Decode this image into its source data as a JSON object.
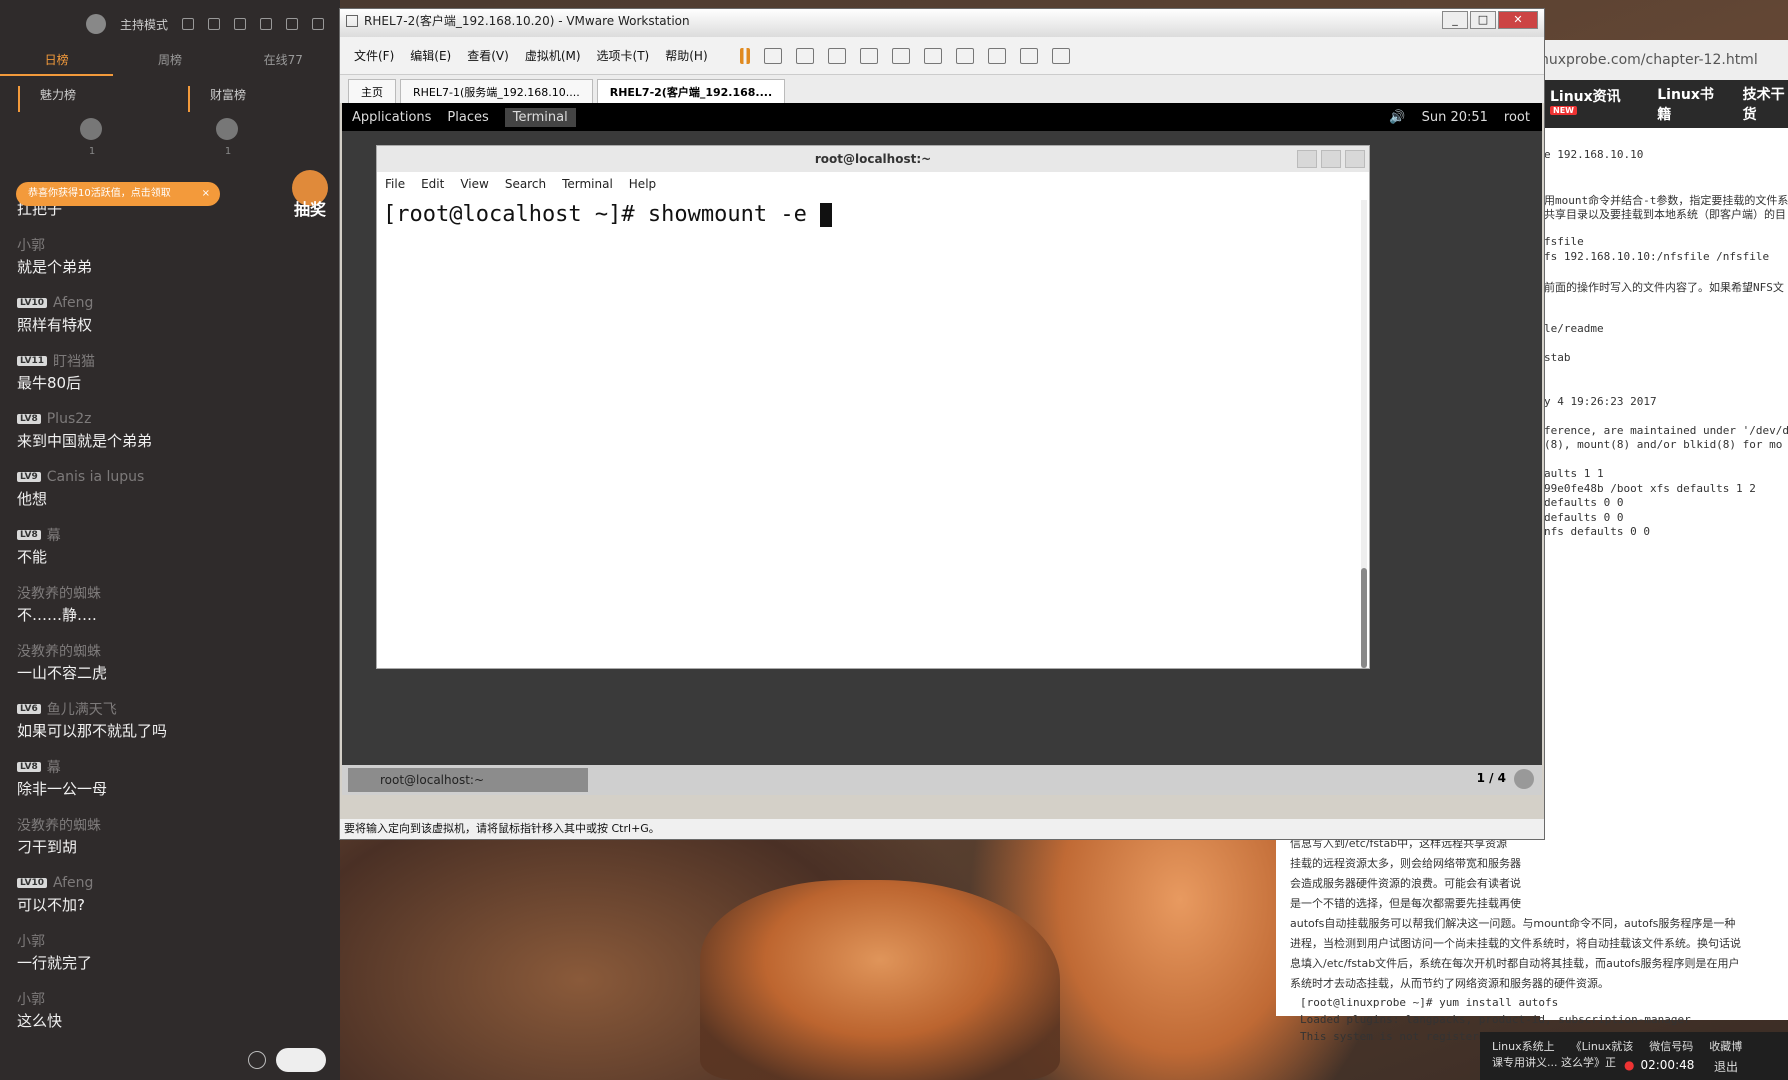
{
  "chat": {
    "host_mode": "主持模式",
    "tabs": [
      "日榜",
      "周榜",
      "在线77"
    ],
    "rank_heads": [
      "魅力榜",
      "财富榜"
    ],
    "rank_counts": [
      "1",
      "1"
    ],
    "toast": "恭喜你获得10活跃值，点击领取",
    "toast_close": "×",
    "lottery": "抽奖",
    "messages": [
      {
        "level": "",
        "user": "",
        "text": "扛把子"
      },
      {
        "level": "",
        "user": "小郭",
        "text": "就是个弟弟"
      },
      {
        "level": "LV10",
        "user": "Afeng",
        "text": "照样有特权"
      },
      {
        "level": "LV11",
        "user": "盯裆猫",
        "text": "最牛80后"
      },
      {
        "level": "LV8",
        "user": "Plus2z",
        "text": "来到中国就是个弟弟"
      },
      {
        "level": "LV9",
        "user": "Canis ia lupus",
        "text": "他想"
      },
      {
        "level": "LV8",
        "user": "幕",
        "text": "不能"
      },
      {
        "level": "",
        "user": "没教养的蜘蛛",
        "text": "不……静…."
      },
      {
        "level": "",
        "user": "没教养的蜘蛛",
        "text": "一山不容二虎"
      },
      {
        "level": "LV6",
        "user": "鱼儿满天飞",
        "text": "如果可以那不就乱了吗"
      },
      {
        "level": "LV8",
        "user": "幕",
        "text": "除非一公一母"
      },
      {
        "level": "",
        "user": "没教养的蜘蛛",
        "text": "刁干到胡"
      },
      {
        "level": "LV10",
        "user": "Afeng",
        "text": "可以不加?"
      },
      {
        "level": "",
        "user": "小郭",
        "text": "一行就完了"
      },
      {
        "level": "",
        "user": "小郭",
        "text": "这么快"
      }
    ]
  },
  "browser": {
    "url": "nuxprobe.com/chapter-12.html",
    "nav": [
      "Linux资讯",
      "Linux书籍",
      "技术干货"
    ],
    "nav_badge": "NEW",
    "lines": [
      "e 192.168.10.10",
      "",
      "",
      "用mount命令并结合-t参数，指定要挂载的文件系",
      "共享目录以及要挂载到本地系统（即客户端）的目",
      "",
      "fsfile",
      "fs 192.168.10.10:/nfsfile /nfsfile",
      "",
      "前面的操作时写入的文件内容了。如果希望NFS文",
      "",
      "",
      "le/readme",
      "",
      "stab",
      "",
      "",
      "y 4 19:26:23 2017",
      "",
      "ference, are maintained under '/dev/d",
      "(8), mount(8) and/or blkid(8) for mo",
      "",
      "aults 1 1",
      "99e0fe48b /boot xfs defaults 1 2",
      "defaults 0 0",
      "defaults 0 0",
      "nfs defaults 0 0"
    ],
    "lower": [
      "信息写入到/etc/fstab中，这样远程共享资源",
      "挂载的远程资源太多，则会给网络带宽和服务器",
      "会造成服务器硬件资源的浪费。可能会有读者说",
      "是一个不错的选择，但是每次都需要先挂载再使",
      "  autofs自动挂载服务可以帮我们解决这一问题。与mount命令不同，autofs服务程序是一种",
      "进程，当检测到用户试图访问一个尚未挂载的文件系统时，将自动挂载该文件系统。换句话说",
      "息填入/etc/fstab文件后，系统在每次开机时都自动将其挂载，而autofs服务程序则是在用户",
      "系统时才去动态挂载，从而节约了网络资源和服务器的硬件资源。"
    ],
    "code": [
      "[root@linuxprobe ~]# yum install autofs",
      "Loaded plugins: langpacks, product-id, subscription-manager",
      "This system is not registered to Red Hat Subscription Management. Yo"
    ]
  },
  "taskbar": {
    "items": [
      "Linux系统上",
      "《Linux就该",
      "微信号码",
      "收藏博"
    ],
    "items2": "课专用讲义...  这么学》正",
    "rec_time": "02:00:48",
    "quit": "退出"
  },
  "vmware": {
    "title": "RHEL7-2(客户端_192.168.10.20) - VMware Workstation",
    "menus": [
      "文件(F)",
      "编辑(E)",
      "查看(V)",
      "虚拟机(M)",
      "选项卡(T)",
      "帮助(H)"
    ],
    "tabs": [
      "主页",
      "RHEL7-1(服务端_192.168.10....",
      "RHEL7-2(客户端_192.168...."
    ],
    "status": "要将输入定向到该虚拟机，请将鼠标指针移入其中或按 Ctrl+G。"
  },
  "gnome": {
    "applications": "Applications",
    "places": "Places",
    "terminal": "Terminal",
    "clock": "Sun 20:51",
    "user": "root",
    "task_item": "root@localhost:~",
    "pager": "1 / 4"
  },
  "terminal": {
    "title": "root@localhost:~",
    "menus": [
      "File",
      "Edit",
      "View",
      "Search",
      "Terminal",
      "Help"
    ],
    "prompt": "[root@localhost ~]# showmount -e "
  }
}
